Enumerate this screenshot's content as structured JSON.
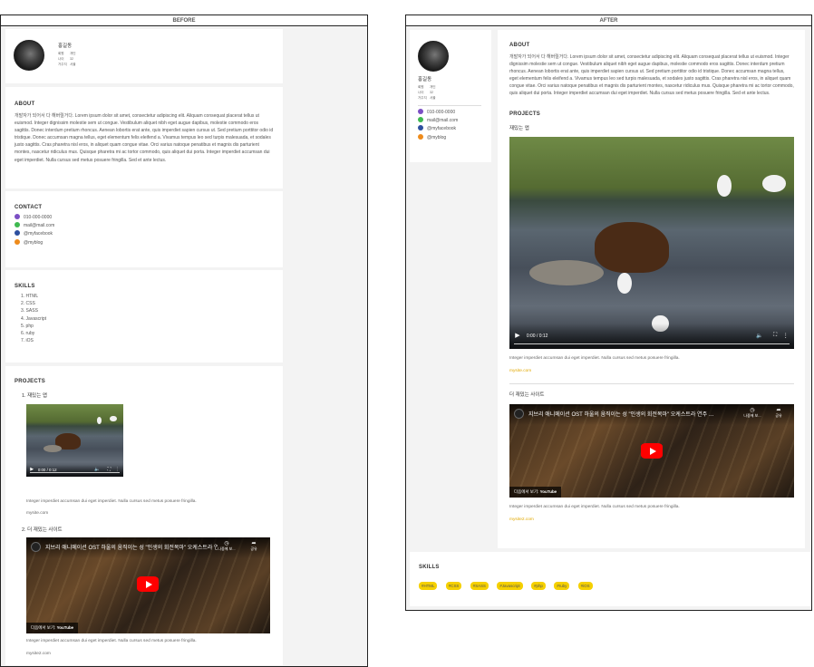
{
  "before": {
    "title": "BEFORE",
    "profile": {
      "name": "홍길동",
      "meta": [
        {
          "key": "회원",
          "val": "개인"
        },
        {
          "key": "나이",
          "val": "32"
        },
        {
          "key": "거주지",
          "val": "서울"
        }
      ]
    },
    "about": {
      "title": "ABOUT",
      "text": "개발자가 되어서 다 해버릴거다. Lorem ipsum dolor sit amet, consectetur adipiscing elit. Aliquam consequat placerat tellus ut euismod. Integer dignissim molestie sem ut congue. Vestibulum aliquet nibh eget augue dapibus, molestie commodo eros sagittis. Donec interdum pretium rhoncus. Aenean lobortis erat ante, quis imperdiet sapien cursus ut. Sed pretium porttitor odio id tristique. Donec accumsan magna tellus, eget elementum felis eleifend a. Vivamus tempus leo sed turpis malesuada, et sodales justo sagittis. Cras pharetra nisl eros, in aliquet quam congue vitae. Orci varius natoque penatibus et magnis dis parturient montes, nascetur ridiculus mus. Quisque pharetra mi ac tortor commodo, quis aliquet dui porta. Integer imperdiet accumsan dui eget imperdiet. Nulla cursus sed metus posuere fringilla. Sed et ante lectus."
    },
    "contact": {
      "title": "CONTACT",
      "items": [
        {
          "icon": "phone-icon",
          "text": "010-000-0000"
        },
        {
          "icon": "mail-icon",
          "text": "mail@mail.com"
        },
        {
          "icon": "facebook-icon",
          "text": "@myfacebook"
        },
        {
          "icon": "blog-icon",
          "text": "@myblog"
        }
      ]
    },
    "skills": {
      "title": "SKILLS",
      "items": [
        "1. HTML",
        "2. CSS",
        "3. SASS",
        "4. Javascript",
        "5. php",
        "6. ruby",
        "7. iOS"
      ]
    },
    "projects": {
      "title": "PROJECTS",
      "items": [
        {
          "title": "1. 재밌는 앱",
          "text": "Integer imperdiet accumsan dui eget imperdiet. Nulla cursus sed metus posuere fringilla.",
          "link": "mysite.com",
          "video_time": "0:00 / 0:12"
        },
        {
          "title": "2. 더 재밌는 사이트",
          "text": "Integer imperdiet accumsan dui eget imperdiet. Nulla cursus sed metus posuere fringilla.",
          "link": "mysite2.com",
          "yt_title": "지브리 애니메이션 OST 하울의 움직이는 성 \"인생의 회전목마\" 오케스트라 연주 …",
          "yt_watch_later": "나중에 보...",
          "yt_share": "공유",
          "yt_watch_on": "다음에서 보기:",
          "yt_brand": "YouTube"
        }
      ]
    }
  },
  "after": {
    "title": "AFTER",
    "profile": {
      "name": "홍길동",
      "meta": [
        {
          "key": "회원",
          "val": "개인"
        },
        {
          "key": "나이",
          "val": "32"
        },
        {
          "key": "거주지",
          "val": "서울"
        }
      ]
    },
    "contact": [
      {
        "icon": "phone-icon",
        "text": "010-000-0000"
      },
      {
        "icon": "mail-icon",
        "text": "mail@mail.com"
      },
      {
        "icon": "facebook-icon",
        "text": "@myfacebook"
      },
      {
        "icon": "blog-icon",
        "text": "@myblog"
      }
    ],
    "about": {
      "title": "ABOUT",
      "text": "개발자가 되어서 다 해버릴거다. Lorem ipsum dolor sit amet, consectetur adipiscing elit. Aliquam consequat placerat tellus ut euismod. Integer dignissim molestie sem ut congue. Vestibulum aliquet nibh eget augue dapibus, molestie commodo eros sagittis. Donec interdum pretium rhoncus. Aenean lobortis erat ante, quis imperdiet sapien cursus ut. Sed pretium porttitor odio id tristique. Donec accumsan magna tellus, eget elementum felis eleifend a. Vivamus tempus leo sed turpis malesuada, et sodales justo sagittis. Cras pharetra nisl eros, in aliquet quam congue vitae. Orci varius natoque penatibus et magnis dis parturient montes, nascetur ridiculus mus. Quisque pharetra mi ac tortor commodo, quis aliquet dui porta. Integer imperdiet accumsan dui eget imperdiet. Nulla cursus sed metus posuere fringilla. Sed et ante lectus."
    },
    "projects": {
      "title": "PROJECTS",
      "items": [
        {
          "title": "재밌는 앱",
          "text": "Integer imperdiet accumsan dui eget imperdiet. Nulla cursus sed metus posuere fringilla.",
          "link": "mysite.com",
          "video_time": "0:00 / 0:12"
        },
        {
          "title": "더 재밌는 사이트",
          "text": "Integer imperdiet accumsan dui eget imperdiet. Nulla cursus sed metus posuere fringilla.",
          "link": "mysite2.com",
          "yt_title": "지브리 애니메이션 OST 하울의 움직이는 성 \"인생의 회전목마\" 오케스트라 연주 …",
          "yt_watch_later": "나중에 보...",
          "yt_share": "공유",
          "yt_watch_on": "다음에서 보기:",
          "yt_brand": "YouTube"
        }
      ]
    },
    "skills": {
      "title": "SKILLS",
      "tags": [
        "#HTML",
        "#CSS",
        "#SASS",
        "#Javascript",
        "#php",
        "#ruby",
        "#iOS"
      ]
    }
  },
  "colors": {
    "tag_bg": "#f5d000",
    "link_yellow": "#e1a800",
    "phone_icon": "#7b4fc4",
    "mail_icon": "#3fb950",
    "facebook_icon": "#2d4f9e",
    "blog_icon": "#ee8b1b"
  }
}
